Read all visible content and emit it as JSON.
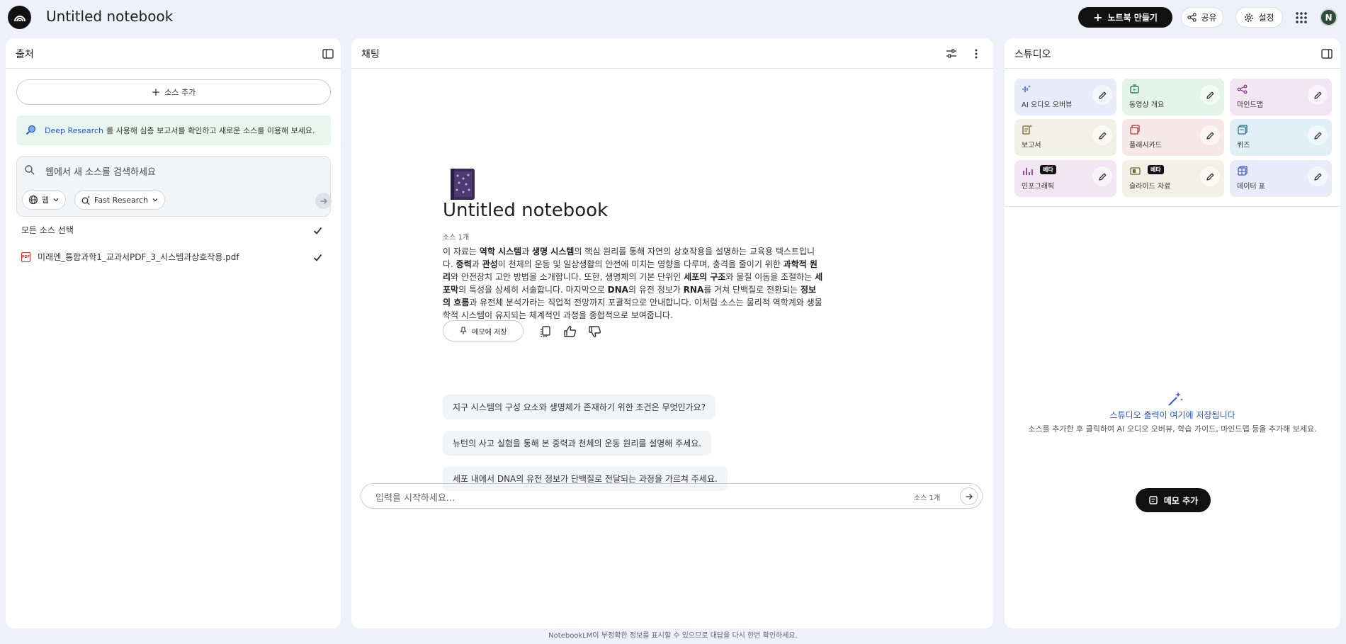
{
  "header": {
    "notebook_title": "Untitled notebook",
    "create_button": "노트북 만들기",
    "share_button": "공유",
    "settings_button": "설정",
    "avatar_initial": "N"
  },
  "sources": {
    "title": "출처",
    "add_source": "소스 추가",
    "deep_research_link": "Deep Research",
    "deep_research_text": "를 사용해 심층 보고서를 확인하고 새로운 소스를 이용해 보세요.",
    "search_placeholder": "웹에서 새 소스를 검색하세요",
    "web_chip": "웹",
    "research_chip": "Fast Research",
    "select_all": "모든 소스 선택",
    "items": [
      {
        "name": "미래엔_통합과학1_교과서PDF_3_시스템과상호작용.pdf",
        "icon": "PDF",
        "checked": true
      }
    ]
  },
  "chat": {
    "title": "채팅",
    "notebook_title": "Untitled notebook",
    "source_count": "소스 1개",
    "summary": {
      "p1": "이 자료는 ",
      "b1": "역학 시스템",
      "p2": "과 ",
      "b2": "생명 시스템",
      "p3": "의 핵심 원리를 통해 자연의 상호작용을 설명하는 교육용 텍스트입니다. ",
      "b3": "중력",
      "p4": "과 ",
      "b4": "관성",
      "p5": "이 천체의 운동 및 일상생활의 안전에 미치는 영향을 다루며, 충격을 줄이기 위한 ",
      "b5": "과학적 원리",
      "p6": "와 안전장치 고안 방법을 소개합니다. 또한, 생명체의 기본 단위인 ",
      "b6": "세포의 구조",
      "p7": "와 물질 이동을 조절하는 ",
      "b7": "세포막",
      "p8": "의 특성을 상세히 서술합니다. 마지막으로 ",
      "b8": "DNA",
      "p9": "의 유전 정보가 ",
      "b9": "RNA",
      "p10": "를 거쳐 단백질로 전환되는 ",
      "b10": "정보의 흐름",
      "p11": "과 유전체 분석가라는 직업적 전망까지 포괄적으로 안내합니다. 이처럼 소스는 물리적 역학계와 생물학적 시스템이 유지되는 체계적인 과정을 종합적으로 보여줍니다."
    },
    "save_memo": "메모에 저장",
    "suggestions": [
      "지구 시스템의 구성 요소와 생명체가 존재하기 위한 조건은 무엇인가요?",
      "뉴턴의 사고 실험을 통해 본 중력과 천체의 운동 원리를 설명해 주세요.",
      "세포 내에서 DNA의 유전 정보가 단백질로 전달되는 과정을 가르쳐 주세요."
    ],
    "input_placeholder": "입력을 시작하세요...",
    "input_source_count": "소스 1개"
  },
  "studio": {
    "title": "스튜디오",
    "tiles": [
      {
        "label": "AI 오디오 오버뷰",
        "color": "#e8ebfa",
        "icon": "audio-icon"
      },
      {
        "label": "동영상 개요",
        "color": "#e3f3e8",
        "icon": "video-icon"
      },
      {
        "label": "마인드맵",
        "color": "#f1e6f1",
        "icon": "mindmap-icon"
      },
      {
        "label": "보고서",
        "color": "#f3f1e6",
        "icon": "report-icon"
      },
      {
        "label": "플래시카드",
        "color": "#f7e8e8",
        "icon": "flashcard-icon"
      },
      {
        "label": "퀴즈",
        "color": "#e1f0f6",
        "icon": "quiz-icon"
      },
      {
        "label": "인포그래픽",
        "color": "#f1e6f1",
        "icon": "infographic-icon",
        "badge": "베타"
      },
      {
        "label": "슬라이드 자료",
        "color": "#f3f1e6",
        "icon": "slides-icon",
        "badge": "베타"
      },
      {
        "label": "데이터 표",
        "color": "#e8ebfa",
        "icon": "table-icon"
      }
    ],
    "empty_title": "스튜디오 출력이 여기에 저장됩니다",
    "empty_desc": "소스를 추가한 후 클릭하여 AI 오디오 오버뷰, 학습 가이드, 마인드맵 등을 추가해 보세요.",
    "add_memo": "메모 추가"
  },
  "footer": "NotebookLM이 부정확한 정보를 표시할 수 있으므로 대답을 다시 한번 확인하세요."
}
